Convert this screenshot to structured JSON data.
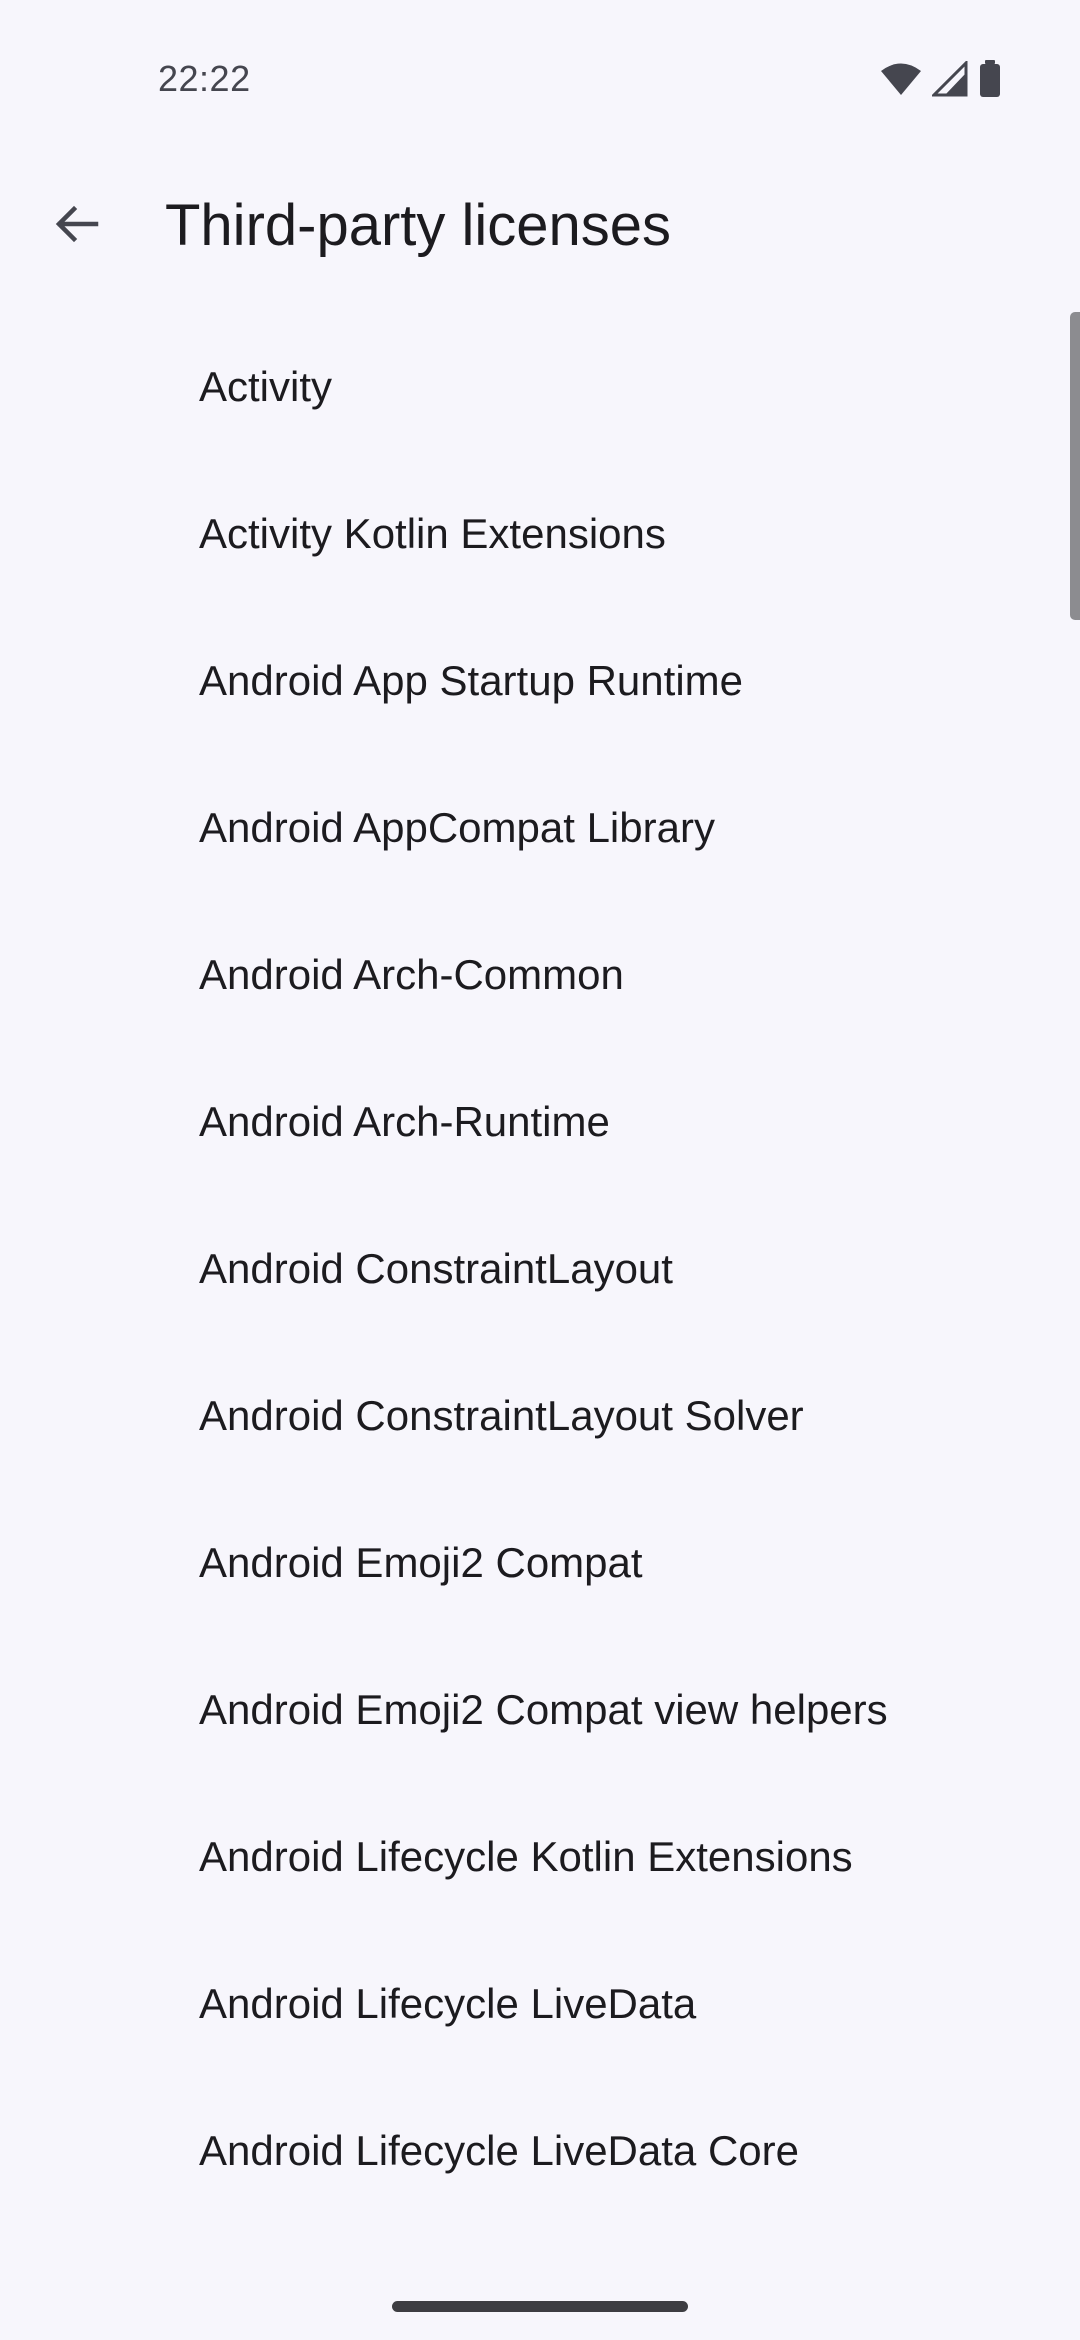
{
  "status_bar": {
    "time": "22:22",
    "icons": [
      "wifi-icon",
      "cell-signal-icon",
      "battery-icon"
    ]
  },
  "top_bar": {
    "back_icon": "arrow-back-icon",
    "title": "Third-party licenses"
  },
  "licenses": [
    "Activity",
    "Activity Kotlin Extensions",
    "Android App Startup Runtime",
    "Android AppCompat Library",
    "Android Arch-Common",
    "Android Arch-Runtime",
    "Android ConstraintLayout",
    "Android ConstraintLayout Solver",
    "Android Emoji2 Compat",
    "Android Emoji2 Compat view helpers",
    "Android Lifecycle Kotlin Extensions",
    "Android Lifecycle LiveData",
    "Android Lifecycle LiveData Core"
  ],
  "colors": {
    "background": "#f7f6fc",
    "text": "#1c1b1f",
    "status_text": "#45464f"
  }
}
